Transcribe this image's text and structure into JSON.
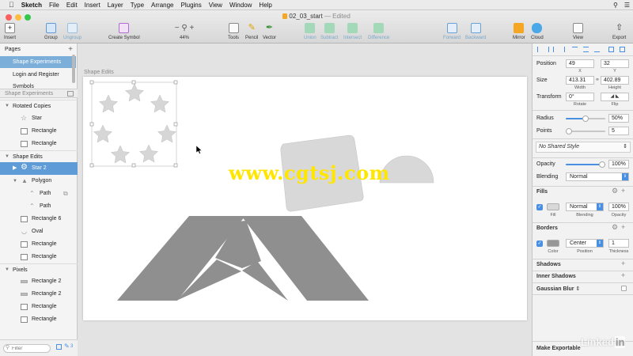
{
  "menubar": {
    "app": "Sketch",
    "items": [
      "File",
      "Edit",
      "Insert",
      "Layer",
      "Type",
      "Arrange",
      "Plugins",
      "View",
      "Window",
      "Help"
    ]
  },
  "window": {
    "title": "02_03_start",
    "edited": "— Edited"
  },
  "toolbar": {
    "insert": "Insert",
    "group": "Group",
    "ungroup": "Ungroup",
    "create_symbol": "Create Symbol",
    "zoom": "44%",
    "tools": "Tools",
    "pencil": "Pencil",
    "vector": "Vector",
    "union": "Union",
    "subtract": "Subtract",
    "intersect": "Intersect",
    "difference": "Difference",
    "forward": "Forward",
    "backward": "Backward",
    "mirror": "Mirror",
    "cloud": "Cloud",
    "view": "View",
    "export": "Export"
  },
  "pages": {
    "header": "Pages",
    "items": [
      "Shape Experiments",
      "Login and Register",
      "Symbols"
    ]
  },
  "layers": {
    "page_name": "Shape Experiments",
    "groups": [
      {
        "name": "Rotated Copies",
        "items": [
          "Star",
          "Rectangle",
          "Rectangle"
        ]
      },
      {
        "name": "Shape Edits",
        "items": [
          "Star 2",
          "Polygon",
          "Path",
          "Path",
          "Rectangle 6",
          "Oval",
          "Rectangle",
          "Rectangle"
        ]
      },
      {
        "name": "Pixels",
        "items": [
          "Rectangle 2",
          "Rectangle 2",
          "Rectangle",
          "Rectangle"
        ]
      }
    ],
    "filter_placeholder": "Filter",
    "count": "3"
  },
  "canvas": {
    "artboard_name": "Shape Edits"
  },
  "inspector": {
    "position_label": "Position",
    "x": "49",
    "y": "32",
    "x_label": "X",
    "y_label": "Y",
    "size_label": "Size",
    "width": "413.31",
    "height": "402.89",
    "width_label": "Width",
    "height_label": "Height",
    "transform_label": "Transform",
    "rotate": "0°",
    "rotate_label": "Rotate",
    "flip_label": "Flip",
    "radius_label": "Radius",
    "radius": "50%",
    "points_label": "Points",
    "points": "5",
    "shared_style": "No Shared Style",
    "opacity_label": "Opacity",
    "opacity": "100%",
    "blending_label": "Blending",
    "blending": "Normal",
    "fills_label": "Fills",
    "fill_blend": "Normal",
    "fill_opacity": "100%",
    "fill_sub": "Fill",
    "fill_blend_sub": "Blending",
    "fill_opacity_sub": "Opacity",
    "borders_label": "Borders",
    "border_position": "Center",
    "border_thickness": "1",
    "border_color_sub": "Color",
    "border_position_sub": "Position",
    "border_thickness_sub": "Thickness",
    "shadows": "Shadows",
    "inner_shadows": "Inner Shadows",
    "gaussian_blur": "Gaussian Blur",
    "make_exportable": "Make Exportable"
  },
  "watermark": "www.cgtsj.com",
  "brand": {
    "linked": "Linked",
    "in": "in"
  },
  "colors": {
    "selection": "#5f9bd6",
    "accent": "#4a90e2",
    "shape_fill": "#d8d8d8",
    "dark_shape": "#8f8f8f"
  }
}
